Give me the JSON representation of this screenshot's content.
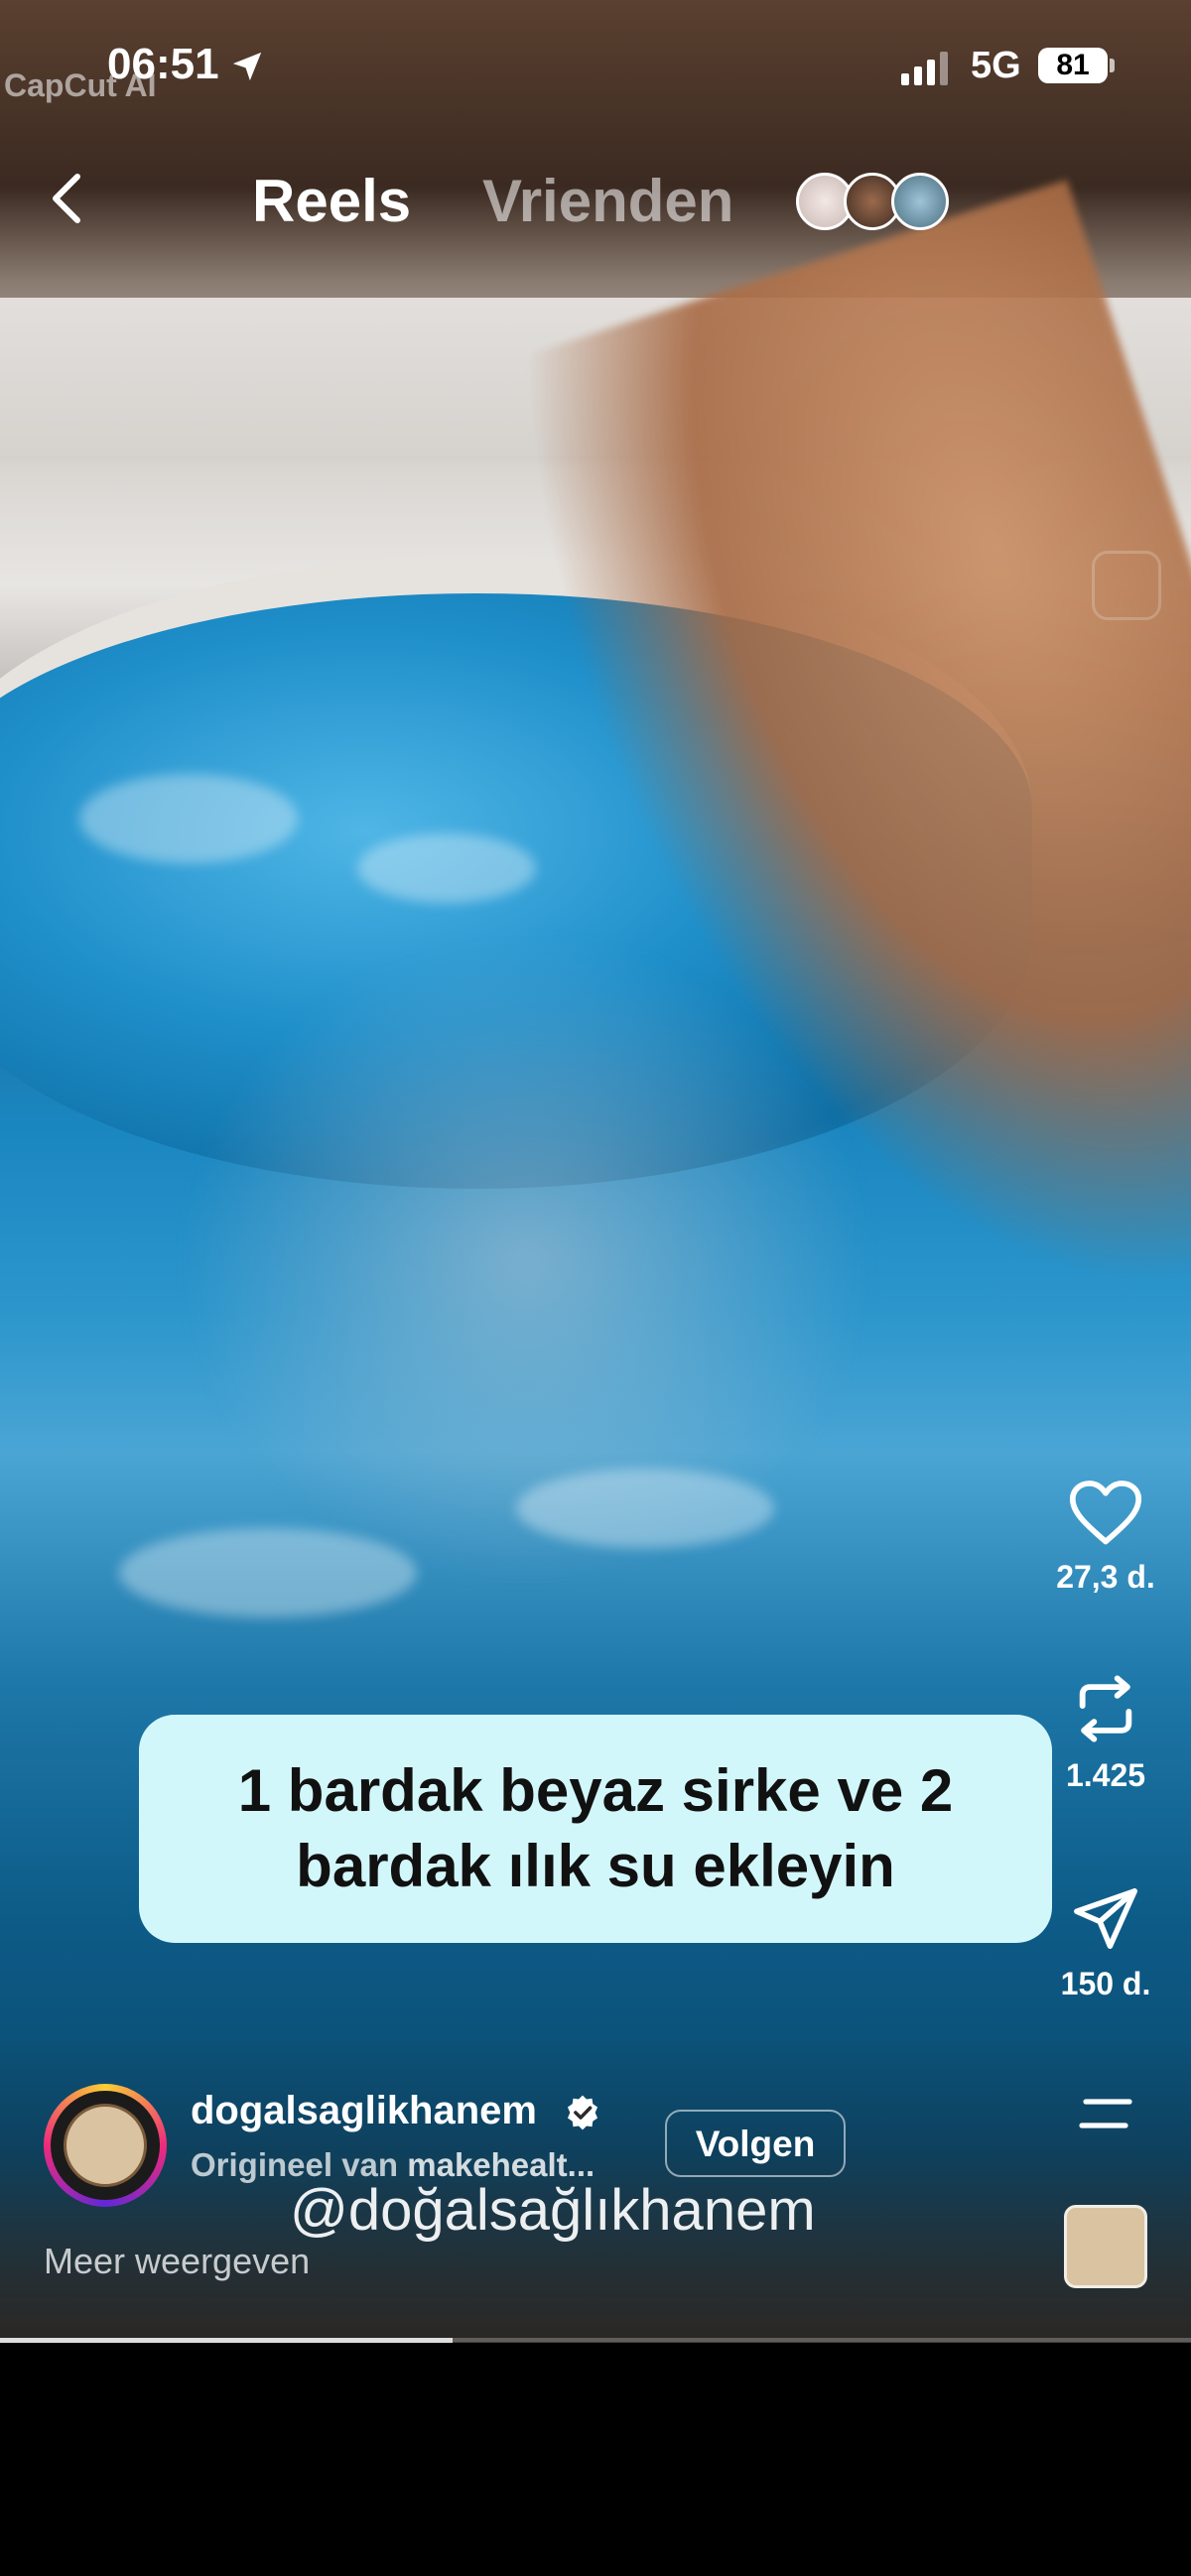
{
  "status_bar": {
    "watermark": "CapCut AI",
    "time": "06:51",
    "network": "5G",
    "battery": "81"
  },
  "header": {
    "tab_reels": "Reels",
    "tab_friends": "Vrienden"
  },
  "actions": {
    "likes": "27,3 d.",
    "reposts": "1.425",
    "shares": "150 d."
  },
  "caption": {
    "text": "1 bardak beyaz sirke ve 2\nbardak ılık su ekleyin"
  },
  "account": {
    "username": "dogalsaglikhanem",
    "origin_prefix": "Origineel van ",
    "origin_name": "makehealt...",
    "follow_label": "Volgen"
  },
  "video": {
    "handle_watermark": "@doğalsağlıkhanem",
    "progress": 0.38
  },
  "more_label": "Meer weergeven"
}
